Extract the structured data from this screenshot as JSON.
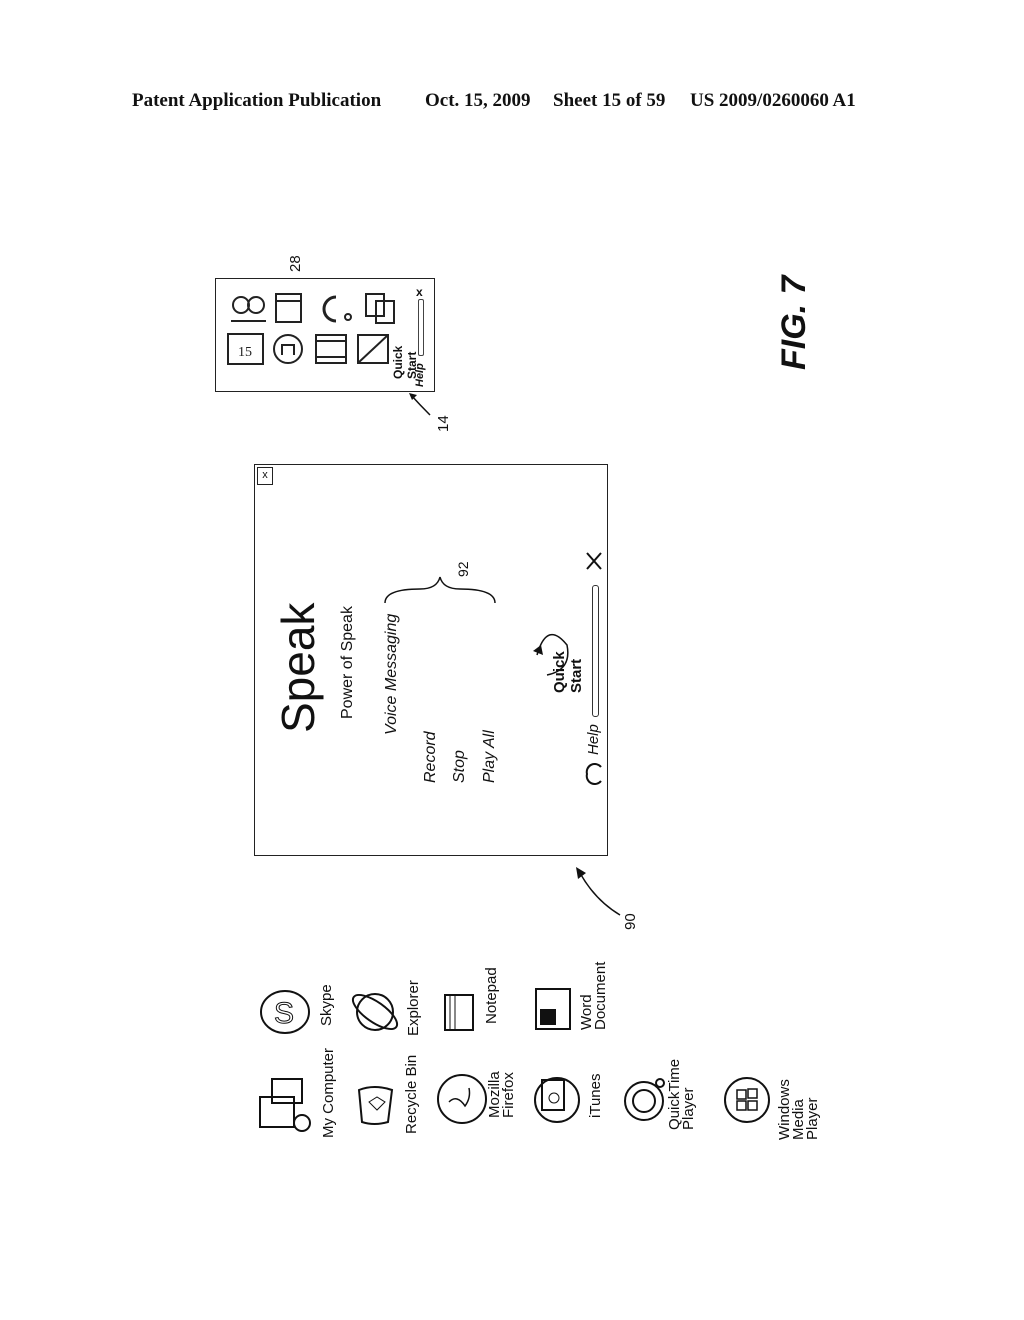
{
  "header": {
    "left": "Patent Application Publication",
    "date": "Oct. 15, 2009",
    "sheet": "Sheet 15 of 59",
    "number": "US 2009/0260060 A1"
  },
  "figure_label": "FIG. 7",
  "toolbar_widget": {
    "ref": "14",
    "icon_ref": "28",
    "icons": [
      "contacts-icon",
      "folder-icon",
      "headset-icon",
      "documents-icon",
      "calendar-icon",
      "upload-icon",
      "film-icon",
      "notebook-icon"
    ],
    "calendar_day": "15",
    "quick_start": "Quick Start",
    "help": "Help",
    "close": "x"
  },
  "speak_window": {
    "ref": "90",
    "brace_ref": "92",
    "title": "Speak",
    "subtitle": "Power of Speak",
    "section": "Voice Messaging",
    "actions": [
      "Record",
      "Stop",
      "Play All"
    ],
    "quick_start": "Quick Start",
    "help": "Help",
    "close": "x"
  },
  "desktop_icons": [
    {
      "label": "Skype"
    },
    {
      "label": "Explorer"
    },
    {
      "label": "Notepad"
    },
    {
      "label": "Word Document"
    },
    {
      "label": "My Computer"
    },
    {
      "label": "Recycle Bin"
    },
    {
      "label": "Mozilla Firefox"
    },
    {
      "label": "iTunes"
    },
    {
      "label": "QuickTime Player"
    },
    {
      "label": "Windows Media Player"
    }
  ]
}
